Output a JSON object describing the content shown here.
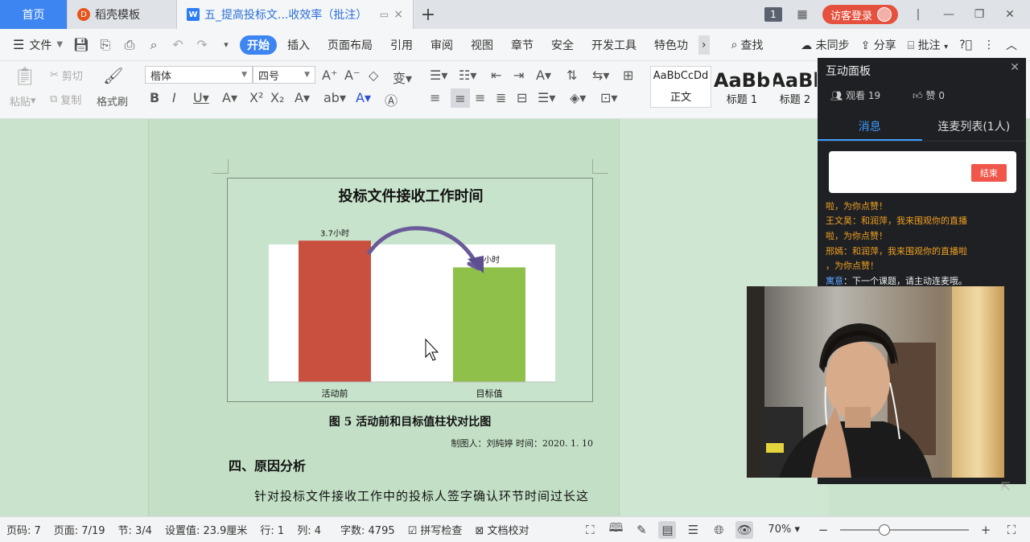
{
  "tabs": {
    "home": "首页",
    "template": "稻壳模板",
    "doc_title": "五_提高投标文...收效率（批注）",
    "plus": "+",
    "badge": "1",
    "guest_login": "访客登录"
  },
  "menu": {
    "file": "文件",
    "items": [
      "开始",
      "插入",
      "页面布局",
      "引用",
      "审阅",
      "视图",
      "章节",
      "安全",
      "开发工具",
      "特色功"
    ],
    "search": "查找",
    "sync": "未同步",
    "share": "分享",
    "comment": "批注"
  },
  "ribbon": {
    "paste": "粘贴",
    "cut": "剪切",
    "copy": "复制",
    "format_painter": "格式刷",
    "font_name": "楷体",
    "font_size": "四号",
    "styles": [
      {
        "sample": "AaBbCcDd",
        "label": "正文"
      },
      {
        "sample": "AaBb",
        "label": "标题 1"
      },
      {
        "sample": "AaBl",
        "label": "标题 2"
      }
    ]
  },
  "document": {
    "figure_caption": "图 5  活动前和目标值柱状对比图",
    "maker_line": "制图人：刘純婷   时间：2020. 1. 10",
    "heading": "四、原因分析",
    "paragraph": "针对投标文件接收工作中的投标人签字确认环节时间过长这一主要症结，小组成员采用头脑风暴法，得到四个末端因素"
  },
  "chart_data": {
    "type": "bar",
    "title": "投标文件接收工作时间",
    "categories": [
      "活动前",
      "目标值"
    ],
    "values": [
      3.7,
      3
    ],
    "data_labels": [
      "3.7小时",
      "3小时"
    ],
    "colors": [
      "#c9503f",
      "#8fc14a"
    ],
    "ylim": [
      0,
      4
    ],
    "grid": false,
    "legend": "none"
  },
  "panel": {
    "title": "互动面板",
    "views": "观看 19",
    "likes": "赞 0",
    "tab_messages": "消息",
    "tab_lianmai": "连麦列表(1人)",
    "end_button": "结束",
    "messages": [
      {
        "who": "",
        "text": "啦，为你点赞！"
      },
      {
        "who": "王文昊",
        "text": "：和润萍，我来围观你的直播"
      },
      {
        "who": "",
        "text": "啦，为你点赞！"
      },
      {
        "who": "邢嫣",
        "text": "：和润萍，我来围观你的直播啦"
      },
      {
        "who": "",
        "text": "，为你点赞！"
      },
      {
        "who": "寓意",
        "text": "：下一个课题，请主动连麦哦。"
      }
    ]
  },
  "status": {
    "page_code": "页码: 7",
    "pages": "页面: 7/19",
    "section": "节: 3/4",
    "setting": "设置值: 23.9厘米",
    "row": "行: 1",
    "col": "列: 4",
    "word_count": "字数: 4795",
    "spell_check": "拼写检查",
    "doc_proof": "文档校对",
    "zoom": "70%"
  }
}
